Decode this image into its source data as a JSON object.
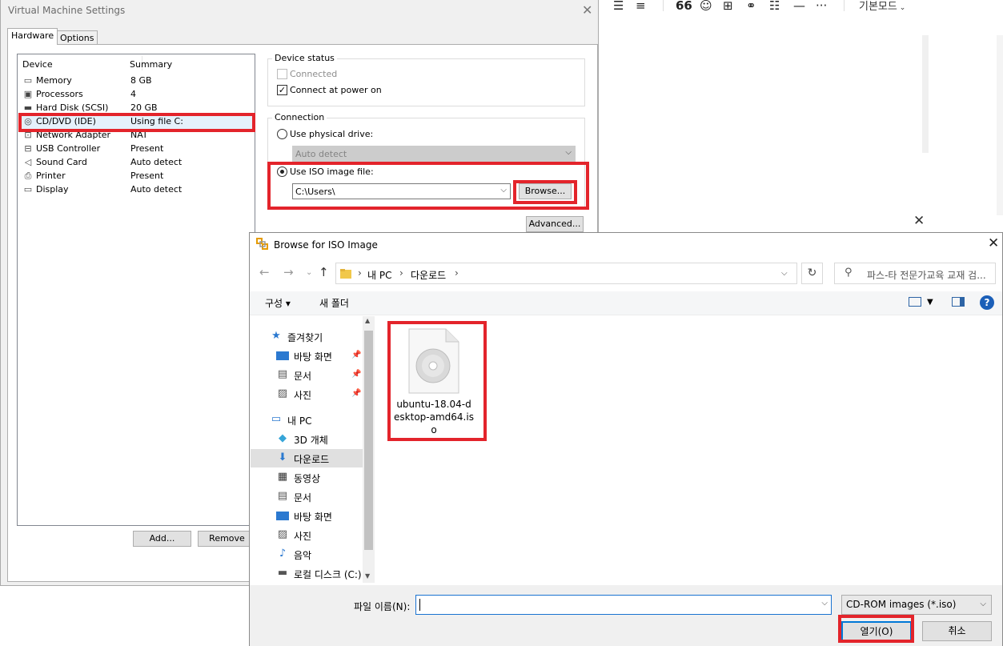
{
  "background": {
    "mode_label": "기본모드",
    "toolbar_icons": [
      "align-right-icon",
      "align-justify-icon",
      "quote-icon",
      "emoji-icon",
      "table-icon",
      "link-icon",
      "list-icon",
      "hr-icon",
      "more-icon"
    ],
    "close_glyph": "✕"
  },
  "vm": {
    "title": "Virtual Machine Settings",
    "tabs": [
      "Hardware",
      "Options"
    ],
    "device_header": "Device",
    "summary_header": "Summary",
    "devices": [
      {
        "name": "Memory",
        "summary": "8 GB",
        "icon": "memory-icon"
      },
      {
        "name": "Processors",
        "summary": "4",
        "icon": "cpu-icon"
      },
      {
        "name": "Hard Disk (SCSI)",
        "summary": "20 GB",
        "icon": "hard-disk-icon"
      },
      {
        "name": "CD/DVD (IDE)",
        "summary": "Using file C:",
        "icon": "cd-dvd-icon"
      },
      {
        "name": "Network Adapter",
        "summary": "NAT",
        "icon": "network-icon"
      },
      {
        "name": "USB Controller",
        "summary": "Present",
        "icon": "usb-icon"
      },
      {
        "name": "Sound Card",
        "summary": "Auto detect",
        "icon": "sound-icon"
      },
      {
        "name": "Printer",
        "summary": "Present",
        "icon": "printer-icon"
      },
      {
        "name": "Display",
        "summary": "Auto detect",
        "icon": "display-icon"
      }
    ],
    "add_button": "Add...",
    "remove_button": "Remove",
    "device_status": {
      "title": "Device status",
      "connected": "Connected",
      "connected_checked": false,
      "connect_at_power_on": "Connect at power on",
      "connect_at_power_on_checked": true
    },
    "connection": {
      "title": "Connection",
      "physical_drive": "Use physical drive:",
      "physical_drive_value": "Auto detect",
      "iso_image": "Use ISO image file:",
      "iso_path": "C:\\Users\\",
      "browse_button": "Browse...",
      "advanced_button": "Advanced..."
    }
  },
  "browse": {
    "title": "Browse for ISO Image",
    "breadcrumb": [
      "내 PC",
      "다운로드"
    ],
    "search_placeholder": "파스-타 전문가교육 교재 검...",
    "organize": "구성 ▾",
    "new_folder": "새 폴더",
    "help": "?",
    "tree": [
      {
        "label": "즐겨찾기",
        "icon": "star-icon",
        "indent": 1,
        "pinned": false
      },
      {
        "label": "바탕 화면",
        "icon": "desktop-icon",
        "indent": 2,
        "pinned": true
      },
      {
        "label": "문서",
        "icon": "document-icon",
        "indent": 2,
        "pinned": true
      },
      {
        "label": "사진",
        "icon": "pictures-icon",
        "indent": 2,
        "pinned": true
      },
      {
        "label": "내 PC",
        "icon": "pc-icon",
        "indent": 1,
        "pinned": false
      },
      {
        "label": "3D 개체",
        "icon": "3d-objects-icon",
        "indent": 2,
        "pinned": false
      },
      {
        "label": "다운로드",
        "icon": "download-icon",
        "indent": 2,
        "pinned": false,
        "selected": true
      },
      {
        "label": "동영상",
        "icon": "video-icon",
        "indent": 2,
        "pinned": false
      },
      {
        "label": "문서",
        "icon": "document-icon",
        "indent": 2,
        "pinned": false
      },
      {
        "label": "바탕 화면",
        "icon": "desktop-icon",
        "indent": 2,
        "pinned": false
      },
      {
        "label": "사진",
        "icon": "pictures-icon",
        "indent": 2,
        "pinned": false
      },
      {
        "label": "음악",
        "icon": "music-icon",
        "indent": 2,
        "pinned": false
      },
      {
        "label": "로컬 디스크 (C:)",
        "icon": "local-disk-icon",
        "indent": 2,
        "pinned": false
      }
    ],
    "file": {
      "name": "ubuntu-18.04-desktop-amd64.iso",
      "icon": "disc-image-icon"
    },
    "filename_label": "파일 이름(N):",
    "filename_value": "",
    "filetype": "CD-ROM images (*.iso)",
    "open_button": "열기(O)",
    "cancel_button": "취소"
  },
  "colors": {
    "highlight": "#e3242b",
    "accent": "#0078d7"
  }
}
